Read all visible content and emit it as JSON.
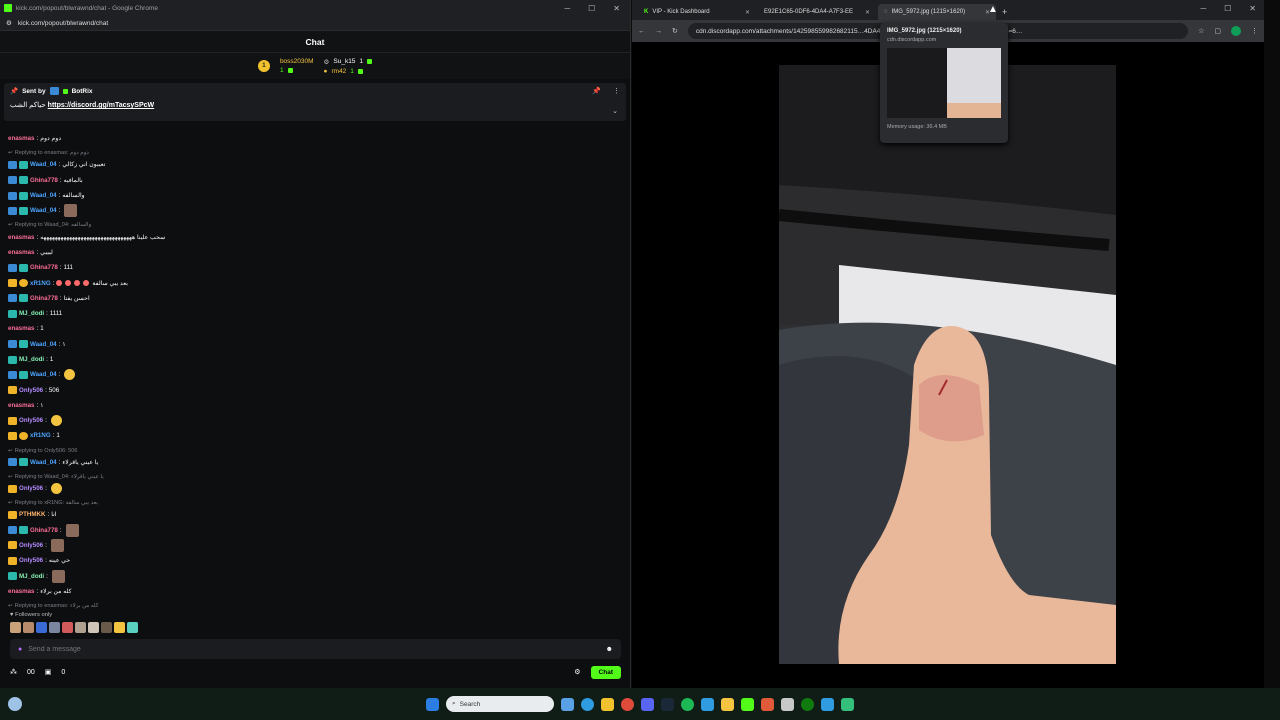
{
  "left_window": {
    "title": "kick.com/popout/blwrawnd/chat - Google Chrome",
    "url": "kick.com/popout/blwrawnd/chat",
    "chat_title": "Chat",
    "leaderboard": [
      {
        "name": "boss2030M",
        "count": "1"
      },
      {
        "name": "Su_k15",
        "count": "1"
      },
      {
        "name": "rm42",
        "count": "1"
      }
    ],
    "pinned": {
      "sent_by_label": "Sent by",
      "sender": "BotRix",
      "text": "حياكم الشب",
      "link": "https://discord.gg/mTacsySPcW"
    },
    "messages": [
      {
        "type": "msg",
        "user": "enasmas",
        "color": "pink",
        "badges": [],
        "text": "دوم دوم"
      },
      {
        "type": "reply",
        "text": "Replying to enasmas: دوم دوم"
      },
      {
        "type": "msg",
        "user": "Waad_04",
        "color": "blue",
        "badges": [
          "vip",
          "sub"
        ],
        "text": "تعيبون اني زكالي"
      },
      {
        "type": "msg",
        "user": "Ghina778",
        "color": "pink",
        "badges": [
          "vip",
          "sub"
        ],
        "text": "بالمافيه"
      },
      {
        "type": "msg",
        "user": "Waad_04",
        "color": "blue",
        "badges": [
          "vip",
          "sub"
        ],
        "text": "والسالفه"
      },
      {
        "type": "msg",
        "user": "Waad_04",
        "color": "blue",
        "badges": [
          "vip",
          "sub"
        ],
        "text": "",
        "image": true
      },
      {
        "type": "reply",
        "text": "Replying to Waad_04: والسالفه"
      },
      {
        "type": "msg",
        "user": "enasmas",
        "color": "pink",
        "badges": [],
        "text": "سحب علينا ههههههههههههههههههههههههههههههههه"
      },
      {
        "type": "msg",
        "user": "enasmas",
        "color": "pink",
        "badges": [],
        "text": "ليييي"
      },
      {
        "type": "msg",
        "user": "Ghina778",
        "color": "pink",
        "badges": [
          "vip",
          "sub"
        ],
        "text": "111"
      },
      {
        "type": "msg",
        "user": "xR1NG",
        "color": "blue",
        "badges": [
          "crown",
          "gift"
        ],
        "text": "بعد يبي سالفة",
        "emojis": 4
      },
      {
        "type": "msg",
        "user": "Ghina778",
        "color": "pink",
        "badges": [
          "vip",
          "sub"
        ],
        "text": "احسن يفتا"
      },
      {
        "type": "msg",
        "user": "MJ_dodi",
        "color": "green",
        "badges": [
          "sub"
        ],
        "text": "1111"
      },
      {
        "type": "msg",
        "user": "enasmas",
        "color": "pink",
        "badges": [],
        "text": "1"
      },
      {
        "type": "msg",
        "user": "Waad_04",
        "color": "blue",
        "badges": [
          "vip",
          "sub"
        ],
        "text": "١"
      },
      {
        "type": "msg",
        "user": "MJ_dodi",
        "color": "green",
        "badges": [
          "sub"
        ],
        "text": "1"
      },
      {
        "type": "msg",
        "user": "Waad_04",
        "color": "blue",
        "badges": [
          "vip",
          "sub"
        ],
        "text": "",
        "emoji": true
      },
      {
        "type": "msg",
        "user": "Only506",
        "color": "purple",
        "badges": [
          "crown"
        ],
        "text": "506"
      },
      {
        "type": "msg",
        "user": "enasmas",
        "color": "pink",
        "badges": [],
        "text": "١"
      },
      {
        "type": "msg",
        "user": "Only506",
        "color": "purple",
        "badges": [
          "crown"
        ],
        "text": "",
        "emoji": true
      },
      {
        "type": "msg",
        "user": "xR1NG",
        "color": "blue",
        "badges": [
          "crown",
          "gift"
        ],
        "text": "1"
      },
      {
        "type": "reply",
        "text": "Replying to Only506: 506"
      },
      {
        "type": "msg",
        "user": "Waad_04",
        "color": "blue",
        "badges": [
          "vip",
          "sub"
        ],
        "text": "يا عيني ياقرلاء"
      },
      {
        "type": "reply",
        "text": "Replying to Waad_04: يا عيني ياقرلاء"
      },
      {
        "type": "msg",
        "user": "Only506",
        "color": "purple",
        "badges": [
          "crown"
        ],
        "text": "",
        "emoji": true
      },
      {
        "type": "reply",
        "text": "Replying to xR1NG: بعد يبي سالفة"
      },
      {
        "type": "msg",
        "user": "PTHMKK",
        "color": "orange",
        "badges": [
          "crown"
        ],
        "text": "انا"
      },
      {
        "type": "msg",
        "user": "Ghina778",
        "color": "pink",
        "badges": [
          "vip",
          "sub"
        ],
        "text": "",
        "image": true
      },
      {
        "type": "msg",
        "user": "Only506",
        "color": "purple",
        "badges": [
          "crown"
        ],
        "text": "",
        "image": true
      },
      {
        "type": "msg",
        "user": "Only506",
        "color": "purple",
        "badges": [
          "crown"
        ],
        "text": "حي عينه"
      },
      {
        "type": "msg",
        "user": "MJ_dodi",
        "color": "green",
        "badges": [
          "sub"
        ],
        "text": "",
        "image": true
      },
      {
        "type": "msg",
        "user": "enasmas",
        "color": "pink",
        "badges": [],
        "text": "كله من برلاء"
      },
      {
        "type": "reply",
        "text": "Replying to enasmas: كله من برلاء"
      },
      {
        "type": "msg",
        "user": "PTHMKK",
        "color": "orange",
        "badges": [
          "crown"
        ],
        "text": "انتحب"
      }
    ],
    "followers_only": "Followers only",
    "input_placeholder": "Send a message",
    "viewers": "00",
    "points": "0",
    "chat_button": "Chat"
  },
  "right_window": {
    "tabs": [
      {
        "label": "VIP - Kick Dashboard",
        "active": false
      },
      {
        "label": "E92E1C65-0DF6-4DA4-A7F3-EE",
        "active": false
      },
      {
        "label": "IMG_5972.jpg (1215×1620)",
        "active": true
      }
    ],
    "url": "cdn.discordapp.com/attachments/14259855998268211​5…4DA4-A7F3-EEFB6C1747F4.jpg?ex=69b1f474&is=6…",
    "tooltip": {
      "title": "IMG_5972.jpg (1215×1620)",
      "domain": "cdn.discordapp.com",
      "memory": "Memory usage: 36.4 MB"
    }
  },
  "taskbar": {
    "search_placeholder": "Search"
  }
}
